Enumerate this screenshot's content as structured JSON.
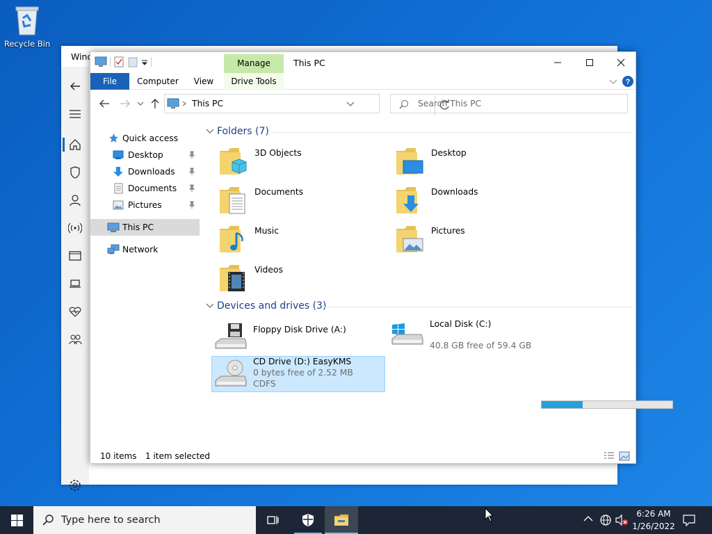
{
  "desktop": {
    "recycle_bin_label": "Recycle Bin"
  },
  "background_window": {
    "title_fragment": "Wind"
  },
  "explorer": {
    "ribbon_context_tab": "Manage",
    "window_title": "This PC",
    "tabs": [
      "File",
      "Computer",
      "View",
      "Drive Tools"
    ],
    "address": "This PC",
    "search_placeholder": "Search This PC",
    "nav": {
      "quick_access": "Quick access",
      "pinned": [
        "Desktop",
        "Downloads",
        "Documents",
        "Pictures"
      ],
      "this_pc": "This PC",
      "network": "Network"
    },
    "folders_header": "Folders (7)",
    "folders": [
      "3D Objects",
      "Desktop",
      "Documents",
      "Downloads",
      "Music",
      "Pictures",
      "Videos"
    ],
    "devices_header": "Devices and drives (3)",
    "drives": {
      "floppy": {
        "name": "Floppy Disk Drive (A:)"
      },
      "local": {
        "name": "Local Disk (C:)",
        "free_text": "40.8 GB free of 59.4 GB",
        "used_fraction": 0.313
      },
      "cd": {
        "name": "CD Drive (D:) EasyKMS",
        "free_text": "0 bytes free of 2.52 MB",
        "fs": "CDFS"
      }
    },
    "status": {
      "items": "10 items",
      "selected": "1 item selected"
    }
  },
  "taskbar": {
    "search_placeholder": "Type here to search",
    "time": "6:26 AM",
    "date": "1/26/2022"
  },
  "colors": {
    "accent": "#1a62b8",
    "selection": "#cce8ff",
    "manage_tab": "#c6e8a8",
    "drive_bar": "#26a0da",
    "group_header": "#1e3f8a"
  }
}
